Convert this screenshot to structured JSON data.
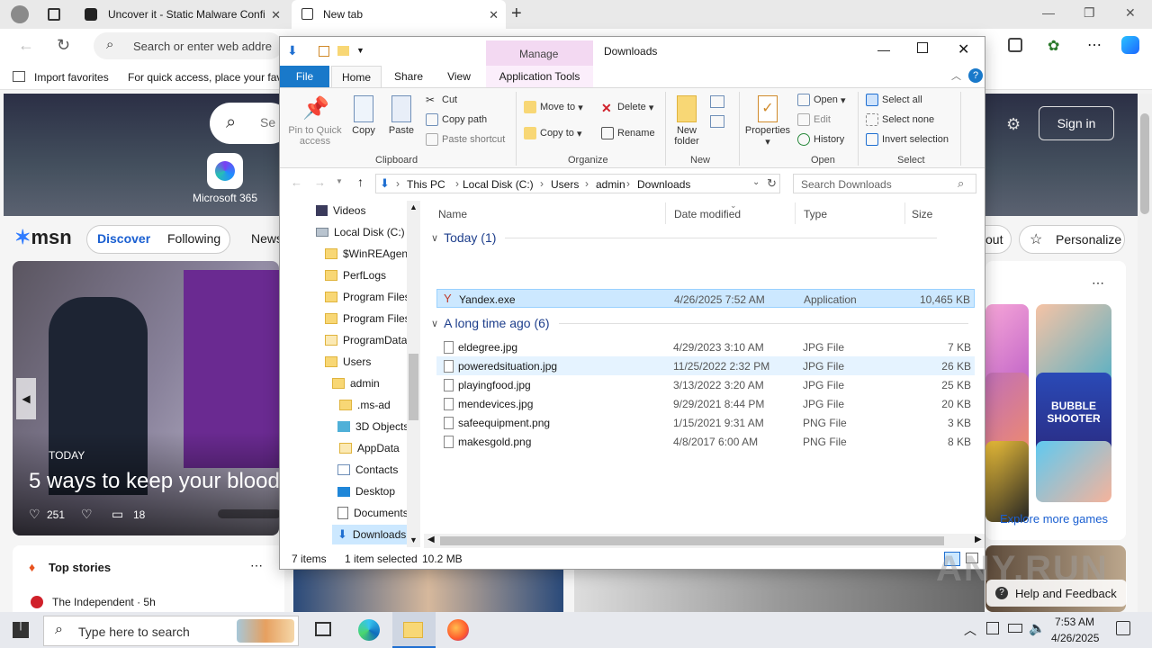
{
  "browser": {
    "tabs": [
      {
        "title": "Uncover it - Static Malware Confi"
      },
      {
        "title": "New tab"
      }
    ],
    "address_placeholder": "Search or enter web addre",
    "favorites": {
      "import_label": "Import favorites",
      "hint": "For quick access, place your fav"
    }
  },
  "msn": {
    "logo": "msn",
    "m365_label": "Microsoft 365",
    "search_placeholder": "Se",
    "nav": {
      "discover": "Discover",
      "following": "Following",
      "news": "News"
    },
    "signin": "Sign in",
    "out": "out",
    "personalize": "Personalize",
    "hero": {
      "badge": "TODAY",
      "headline": "5 ways to keep your blood",
      "likes": "251",
      "comments": "18"
    },
    "topstories": {
      "title": "Top stories",
      "source": "The Independent · 5h"
    },
    "explore_games": "Explore more games",
    "bubble_label": "BUBBLE SHOOTER",
    "help": "Help and Feedback"
  },
  "explorer": {
    "title": "Downloads",
    "manage_tab": "Manage",
    "ribbon_tabs": [
      "File",
      "Home",
      "Share",
      "View",
      "Application Tools"
    ],
    "clipboard": {
      "pin": "Pin to Quick access",
      "copy": "Copy",
      "paste": "Paste",
      "cut": "Cut",
      "copy_path": "Copy path",
      "paste_shortcut": "Paste shortcut",
      "label": "Clipboard"
    },
    "organize": {
      "move_to": "Move to",
      "copy_to": "Copy to",
      "delete": "Delete",
      "rename": "Rename",
      "label": "Organize"
    },
    "new": {
      "new_folder": "New folder",
      "label": "New"
    },
    "open": {
      "properties": "Properties",
      "open": "Open",
      "edit": "Edit",
      "history": "History",
      "label": "Open"
    },
    "select": {
      "select_all": "Select all",
      "select_none": "Select none",
      "invert": "Invert selection",
      "label": "Select"
    },
    "breadcrumb": [
      "This PC",
      "Local Disk (C:)",
      "Users",
      "admin",
      "Downloads"
    ],
    "search_placeholder": "Search Downloads",
    "nav_items": [
      "Videos",
      "Local Disk (C:)",
      "$WinREAgent",
      "PerfLogs",
      "Program Files",
      "Program Files",
      "ProgramData",
      "Users",
      "admin",
      ".ms-ad",
      "3D Objects",
      "AppData",
      "Contacts",
      "Desktop",
      "Documents",
      "Downloads"
    ],
    "columns": {
      "name": "Name",
      "date": "Date modified",
      "type": "Type",
      "size": "Size"
    },
    "groups": [
      {
        "title": "Today (1)",
        "files": [
          {
            "name": "Yandex.exe",
            "date": "4/26/2025 7:52 AM",
            "type": "Application",
            "size": "10,465 KB"
          }
        ]
      },
      {
        "title": "A long time ago (6)",
        "files": [
          {
            "name": "eldegree.jpg",
            "date": "4/29/2023 3:10 AM",
            "type": "JPG File",
            "size": "7 KB"
          },
          {
            "name": "poweredsituation.jpg",
            "date": "11/25/2022 2:32 PM",
            "type": "JPG File",
            "size": "26 KB"
          },
          {
            "name": "playingfood.jpg",
            "date": "3/13/2022 3:20 AM",
            "type": "JPG File",
            "size": "25 KB"
          },
          {
            "name": "mendevices.jpg",
            "date": "9/29/2021 8:44 PM",
            "type": "JPG File",
            "size": "20 KB"
          },
          {
            "name": "safeequipment.png",
            "date": "1/15/2021 9:31 AM",
            "type": "PNG File",
            "size": "3 KB"
          },
          {
            "name": "makesgold.png",
            "date": "4/8/2017 6:00 AM",
            "type": "PNG File",
            "size": "8 KB"
          }
        ]
      }
    ],
    "status": {
      "count": "7 items",
      "selected": "1 item selected",
      "size": "10.2 MB"
    }
  },
  "taskbar": {
    "search_placeholder": "Type here to search",
    "time": "7:53 AM",
    "date": "4/26/2025"
  },
  "watermark": "ANY.RUN"
}
